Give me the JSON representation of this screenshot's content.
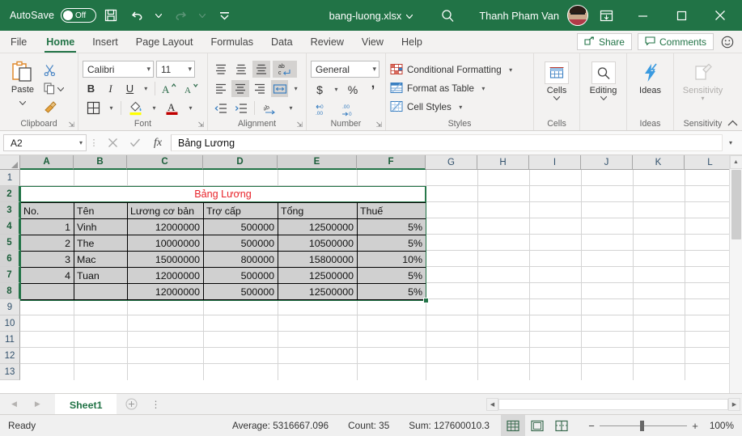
{
  "titlebar": {
    "autosave_label": "AutoSave",
    "autosave_state": "Off",
    "save_icon": "save-icon",
    "undo_icon": "undo-icon",
    "redo_icon": "redo-icon",
    "customize_icon": "customize-quick-access-icon",
    "filename": "bang-luong.xlsx",
    "filename_caret": "▾",
    "search_icon": "search-icon",
    "username": "Thanh Pham Van",
    "avatar": "user-avatar",
    "ribbon_display_icon": "ribbon-display-options-icon",
    "minimize": "—",
    "maximize": "☐",
    "close": "✕",
    "bg_color": "#217346"
  },
  "tabs": [
    {
      "label": "File",
      "active": false
    },
    {
      "label": "Home",
      "active": true
    },
    {
      "label": "Insert",
      "active": false
    },
    {
      "label": "Page Layout",
      "active": false
    },
    {
      "label": "Formulas",
      "active": false
    },
    {
      "label": "Data",
      "active": false
    },
    {
      "label": "Review",
      "active": false
    },
    {
      "label": "View",
      "active": false
    },
    {
      "label": "Help",
      "active": false
    }
  ],
  "tabstrip_right": {
    "share_label": "Share",
    "share_icon": "share-icon",
    "comments_label": "Comments",
    "comments_icon": "comment-icon",
    "feedback_icon": "smiley-icon"
  },
  "ribbon": {
    "accent_color": "#217346",
    "clipboard": {
      "group_label": "Clipboard",
      "paste_label": "Paste",
      "paste_caret": "ˇ",
      "cut_icon": "scissors-icon",
      "copy_icon": "copy-icon",
      "format_painter_icon": "format-painter-icon",
      "dialog_launcher": "dialog-launcher"
    },
    "font": {
      "group_label": "Font",
      "font_name": "Calibri",
      "font_size": "11",
      "bold": "B",
      "italic": "I",
      "underline": "U",
      "grow_font": "A",
      "shrink_font": "A",
      "borders_icon": "borders-icon",
      "fill_color_icon": "fill-color-icon",
      "font_color_icon": "font-color-icon",
      "fill_color": "#ffff00",
      "font_color_swatch": "#c00000",
      "dialog_launcher": "dialog-launcher"
    },
    "alignment": {
      "group_label": "Alignment",
      "align_top": "align-top-icon",
      "align_middle": "align-middle-icon",
      "align_bottom": "align-bottom-icon",
      "wrap_text": "wrap-text-icon",
      "align_left": "align-left-icon",
      "align_center": "align-center-icon",
      "align_right": "align-right-icon",
      "merge_center": "merge-and-center-icon",
      "decrease_indent": "decrease-indent-icon",
      "increase_indent": "increase-indent-icon",
      "orientation": "orientation-icon",
      "dialog_launcher": "dialog-launcher"
    },
    "number": {
      "group_label": "Number",
      "format": "General",
      "accounting": "$",
      "percent": "%",
      "comma": ",",
      "increase_decimal": "increase-decimal-icon",
      "decrease_decimal": "decrease-decimal-icon",
      "dialog_launcher": "dialog-launcher"
    },
    "styles": {
      "group_label": "Styles",
      "conditional_formatting": "Conditional Formatting",
      "format_as_table": "Format as Table",
      "cell_styles": "Cell Styles"
    },
    "cells": {
      "group_label": "Cells",
      "label": "Cells",
      "icon": "cells-icon"
    },
    "editing": {
      "group_label": "Editing",
      "label": "Editing",
      "icon": "editing-find-icon"
    },
    "ideas": {
      "group_label": "Ideas",
      "label": "Ideas",
      "icon": "ideas-lightning-icon"
    },
    "sensitivity": {
      "group_label": "Sensitivity",
      "label": "Sensitivity",
      "icon": "sensitivity-icon",
      "disabled": true
    },
    "collapse_icon": "collapse-ribbon-icon"
  },
  "formulabar": {
    "name_box": "A2",
    "name_box_caret": "▾",
    "cancel_icon": "cancel-icon",
    "enter_icon": "confirm-checkmark-icon",
    "function_icon": "insert-function-fx",
    "formula_value": "Bảng Lương",
    "expand_caret": "▾"
  },
  "grid": {
    "columns": [
      "A",
      "B",
      "C",
      "D",
      "E",
      "F",
      "G",
      "H",
      "I",
      "J",
      "K",
      "L"
    ],
    "rows": [
      "1",
      "2",
      "3",
      "4",
      "5",
      "6",
      "7",
      "8",
      "9",
      "10",
      "11",
      "12",
      "13"
    ],
    "selected_columns": [
      "A",
      "B",
      "C",
      "D",
      "E",
      "F"
    ],
    "selected_rows": [
      "2",
      "3",
      "4",
      "5",
      "6",
      "7",
      "8"
    ],
    "title_cell": {
      "text": "Bảng Lương",
      "color": "#e8232a",
      "range": "A2:F2"
    },
    "headers": [
      "No.",
      "Tên",
      "Lương cơ bản",
      "Trợ cấp",
      "Tổng",
      "Thuế"
    ],
    "data_rows": [
      {
        "no": "1",
        "ten": "Vinh",
        "luong": "12000000",
        "trocap": "500000",
        "tong": "12500000",
        "thue": "5%"
      },
      {
        "no": "2",
        "ten": "The",
        "luong": "10000000",
        "trocap": "500000",
        "tong": "10500000",
        "thue": "5%"
      },
      {
        "no": "3",
        "ten": "Mac",
        "luong": "15000000",
        "trocap": "800000",
        "tong": "15800000",
        "thue": "10%"
      },
      {
        "no": "4",
        "ten": "Tuan",
        "luong": "12000000",
        "trocap": "500000",
        "tong": "12500000",
        "thue": "5%"
      },
      {
        "no": "",
        "ten": "",
        "luong": "12000000",
        "trocap": "500000",
        "tong": "12500000",
        "thue": "5%"
      }
    ],
    "selection_color": "#217346"
  },
  "sheetbar": {
    "prev_icon": "previous-sheet-icon",
    "next_icon": "next-sheet-icon",
    "sheet_name": "Sheet1",
    "add_sheet_icon": "add-sheet-icon",
    "scroll_left_icon": "scroll-left-icon",
    "scroll_right_icon": "scroll-right-icon"
  },
  "statusbar": {
    "mode": "Ready",
    "average": "Average: 5316667.096",
    "count": "Count: 35",
    "sum": "Sum: 127600010.3",
    "view_normal": "normal-view-icon",
    "view_page_layout": "page-layout-view-icon",
    "view_page_break": "page-break-preview-icon",
    "zoom_out": "−",
    "zoom_in": "+",
    "zoom_level": "100%"
  }
}
